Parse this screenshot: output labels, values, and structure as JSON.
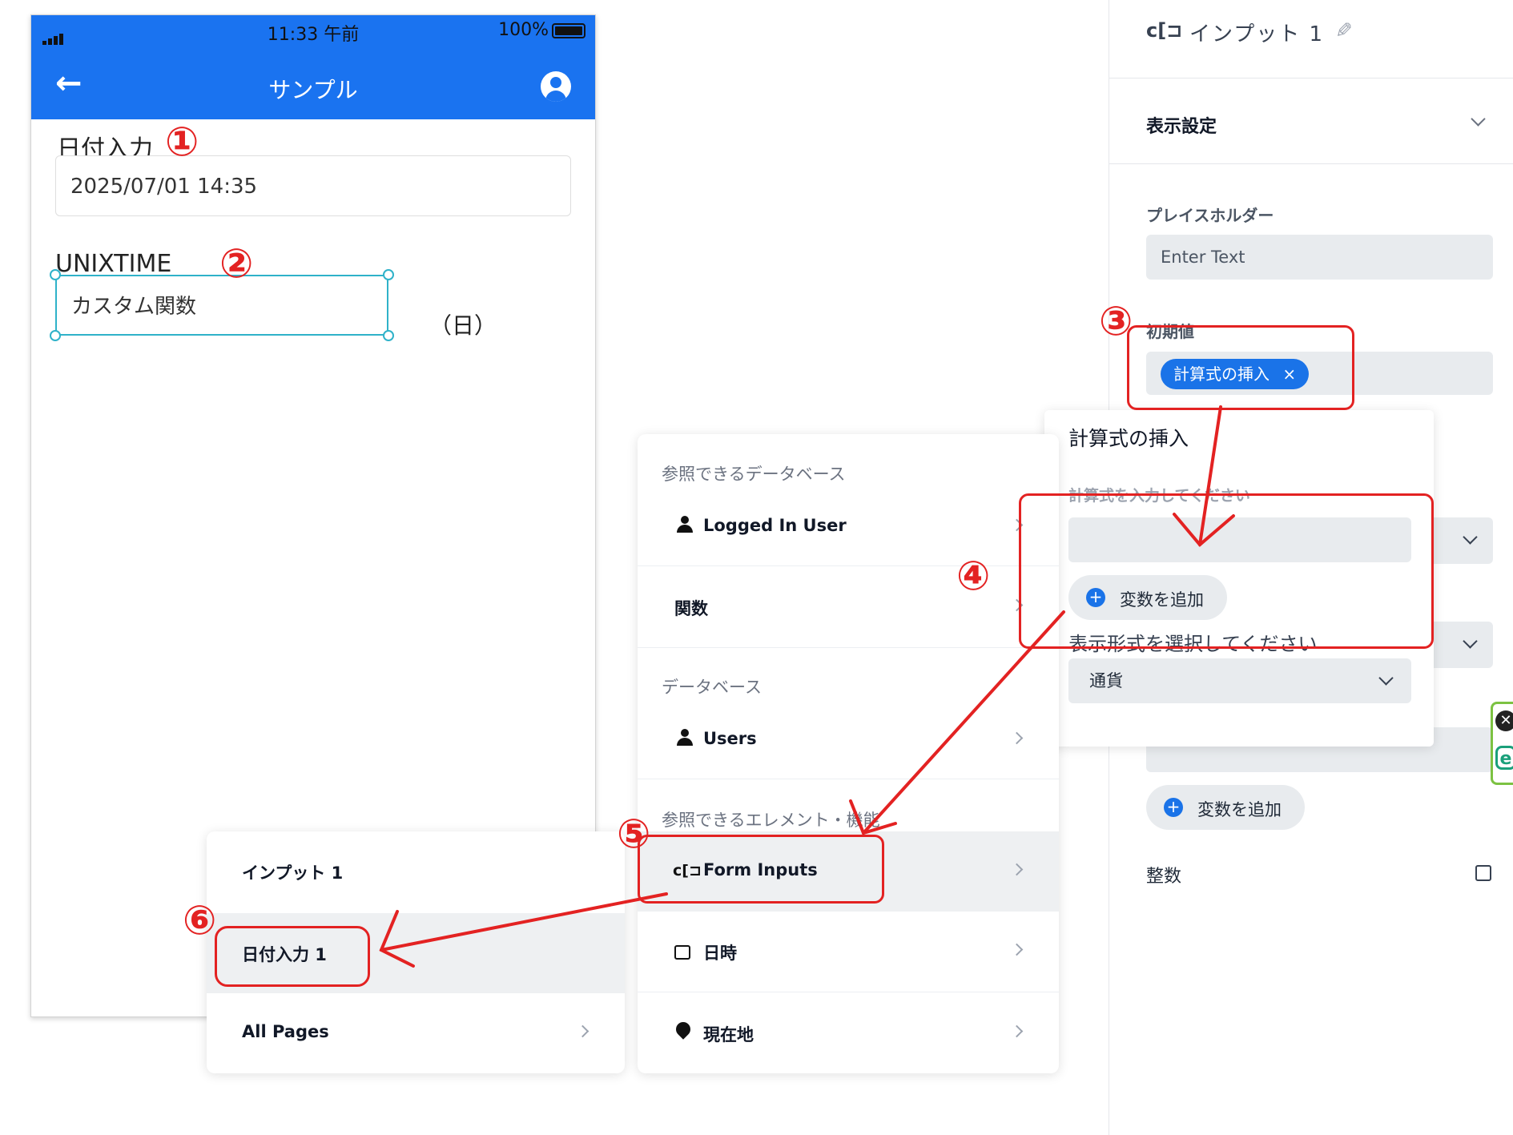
{
  "phone": {
    "status": {
      "time": "11:33 午前",
      "battery": "100%"
    },
    "appbar": {
      "title": "サンプル",
      "back_icon": "arrow-left-icon",
      "account_icon": "account-circle-icon"
    },
    "date_field": {
      "label": "日付入力",
      "value": "2025/07/01 14:35"
    },
    "unix_field": {
      "label": "UNIXTIME",
      "value": "カスタム関数",
      "suffix": "（日）"
    }
  },
  "annotations": {
    "n1": "①",
    "n2": "②",
    "n3": "③",
    "n4": "④",
    "n5": "⑤",
    "n6": "⑥",
    "color": "#e32222"
  },
  "right_panel": {
    "element_title": "インプット 1",
    "display_settings": "表示設定",
    "placeholder_label": "プレイスホルダー",
    "placeholder_value": "Enter Text",
    "initial_value_label": "初期値",
    "chip_label": "計算式の挿入",
    "chip_close": "×",
    "add_variable": "変数を追加",
    "integer_label": "整数"
  },
  "formula_popup": {
    "title": "計算式の挿入",
    "prompt": "計算式を入力してください",
    "add_variable": "変数を追加",
    "format_prompt": "表示形式を選択してください",
    "format_value": "通貨"
  },
  "main_menu": {
    "sec_ref_db": "参照できるデータベース",
    "logged_in_user": "Logged In User",
    "functions": "関数",
    "sec_db": "データベース",
    "users": "Users",
    "sec_elements": "参照できるエレメント・機能",
    "form_inputs": "Form Inputs",
    "datetime": "日時",
    "location": "現在地"
  },
  "sub_menu": {
    "input1": "インプット 1",
    "date_input1": "日付入力 1",
    "all_pages": "All Pages"
  },
  "colors": {
    "accent": "#1a73f0",
    "annotation": "#e32222",
    "selection": "#2fb2c9"
  }
}
